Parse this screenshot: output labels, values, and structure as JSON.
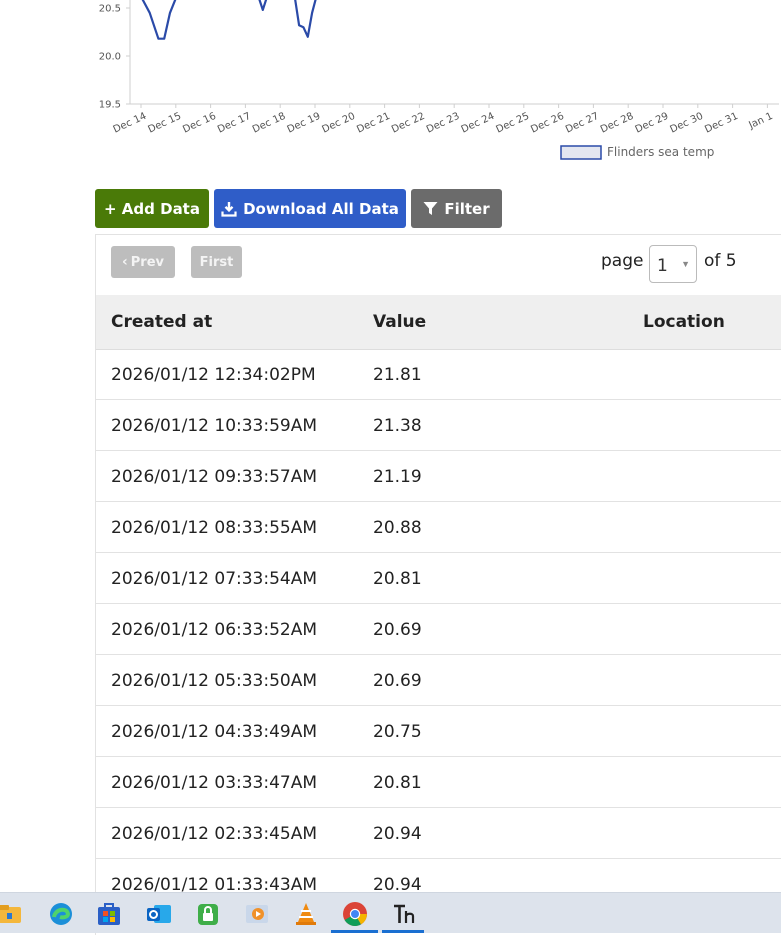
{
  "chart_data": {
    "type": "line",
    "y_ticks": [
      "20.5",
      "20.0",
      "19.5"
    ],
    "ylim": [
      19.5,
      21.0
    ],
    "x_tick_labels": [
      "Dec 14",
      "Dec 15",
      "Dec 16",
      "Dec 17",
      "Dec 18",
      "Dec 19",
      "Dec 20",
      "Dec 21",
      "Dec 22",
      "Dec 23",
      "Dec 24",
      "Dec 25",
      "Dec 26",
      "Dec 27",
      "Dec 28",
      "Dec 29",
      "Dec 30",
      "Dec 31",
      "Jan 1"
    ],
    "series": [
      {
        "name": "Flinders sea temp",
        "color": "#2a4aa8",
        "points": [
          {
            "x": "Dec 14 00:00",
            "y": 20.62
          },
          {
            "x": "Dec 14 06:00",
            "y": 20.45
          },
          {
            "x": "Dec 14 12:00",
            "y": 20.18
          },
          {
            "x": "Dec 14 16:00",
            "y": 20.18
          },
          {
            "x": "Dec 14 20:00",
            "y": 20.45
          },
          {
            "x": "Dec 15 00:00",
            "y": 20.6
          },
          {
            "x": "Dec 17 09:00",
            "y": 20.62
          },
          {
            "x": "Dec 17 12:00",
            "y": 20.48
          },
          {
            "x": "Dec 17 15:00",
            "y": 20.62
          },
          {
            "x": "Dec 18 10:00",
            "y": 20.62
          },
          {
            "x": "Dec 18 13:00",
            "y": 20.32
          },
          {
            "x": "Dec 18 16:00",
            "y": 20.3
          },
          {
            "x": "Dec 18 19:00",
            "y": 20.2
          },
          {
            "x": "Dec 18 22:00",
            "y": 20.45
          },
          {
            "x": "Dec 19 01:00",
            "y": 20.62
          }
        ]
      }
    ],
    "legend": "bottom-right"
  },
  "toolbar": {
    "add_label": "+ Add Data",
    "download_label": "Download All Data",
    "filter_label": "Filter"
  },
  "pager": {
    "prev_label": "Prev",
    "first_label": "First",
    "page_label": "page",
    "page_value": "1",
    "of_label": "of 5"
  },
  "table": {
    "headers": {
      "created": "Created at",
      "value": "Value",
      "location": "Location"
    },
    "rows": [
      {
        "created": "2026/01/12 12:34:02PM",
        "value": "21.81"
      },
      {
        "created": "2026/01/12 10:33:59AM",
        "value": "21.38"
      },
      {
        "created": "2026/01/12 09:33:57AM",
        "value": "21.19"
      },
      {
        "created": "2026/01/12 08:33:55AM",
        "value": "20.88"
      },
      {
        "created": "2026/01/12 07:33:54AM",
        "value": "20.81"
      },
      {
        "created": "2026/01/12 06:33:52AM",
        "value": "20.69"
      },
      {
        "created": "2026/01/12 05:33:50AM",
        "value": "20.69"
      },
      {
        "created": "2026/01/12 04:33:49AM",
        "value": "20.75"
      },
      {
        "created": "2026/01/12 03:33:47AM",
        "value": "20.81"
      },
      {
        "created": "2026/01/12 02:33:45AM",
        "value": "20.94"
      },
      {
        "created": "2026/01/12 01:33:43AM",
        "value": "20.94"
      }
    ]
  },
  "taskbar": {
    "icons": [
      "file-explorer-icon",
      "edge-icon",
      "store-icon",
      "outlook-icon",
      "vpn-lock-icon",
      "media-player-icon",
      "vlc-icon",
      "chrome-icon",
      "typora-icon"
    ],
    "active": [
      "chrome-icon",
      "typora-icon"
    ]
  }
}
